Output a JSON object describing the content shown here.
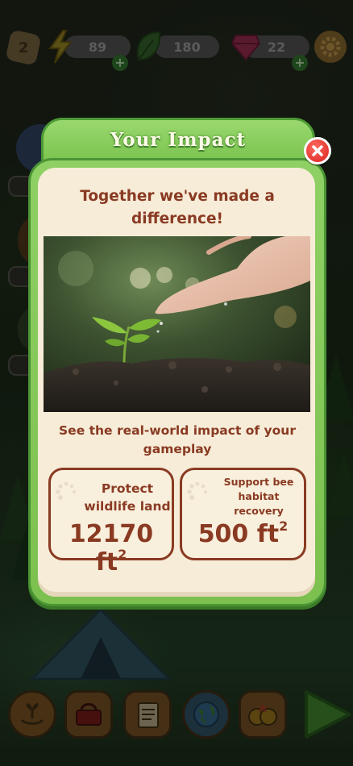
{
  "hud": {
    "level": "2",
    "energy": "89",
    "leaves": "180",
    "gems": "22",
    "plus_symbol": "+"
  },
  "modal": {
    "title": "Your Impact",
    "headline_line1": "Together we've made a",
    "headline_line2": "difference!",
    "subhead_line1": "See the real-world impact of your",
    "subhead_line2": "gameplay",
    "cards": [
      {
        "label_lines": [
          "Protect",
          "wildlife land"
        ],
        "value": "12170 ft",
        "unit_exp": "2"
      },
      {
        "label_lines": [
          "Support bee",
          "habitat",
          "recovery"
        ],
        "value": "500 ft",
        "unit_exp": "2"
      }
    ]
  },
  "icons": {
    "level": "level-badge-icon",
    "energy": "lightning-icon",
    "leaves": "leaf-icon",
    "gems": "gem-icon",
    "settings": "gear-icon",
    "close": "close-icon",
    "nav": [
      "sprout-hand-icon",
      "basket-icon",
      "notebook-icon",
      "globe-icon",
      "friends-icon",
      "play-icon"
    ]
  },
  "colors": {
    "header_green": "#7fc653",
    "panel_cream": "#f6ecd8",
    "text_brown": "#8a3a22",
    "close_red": "#d8221d"
  }
}
